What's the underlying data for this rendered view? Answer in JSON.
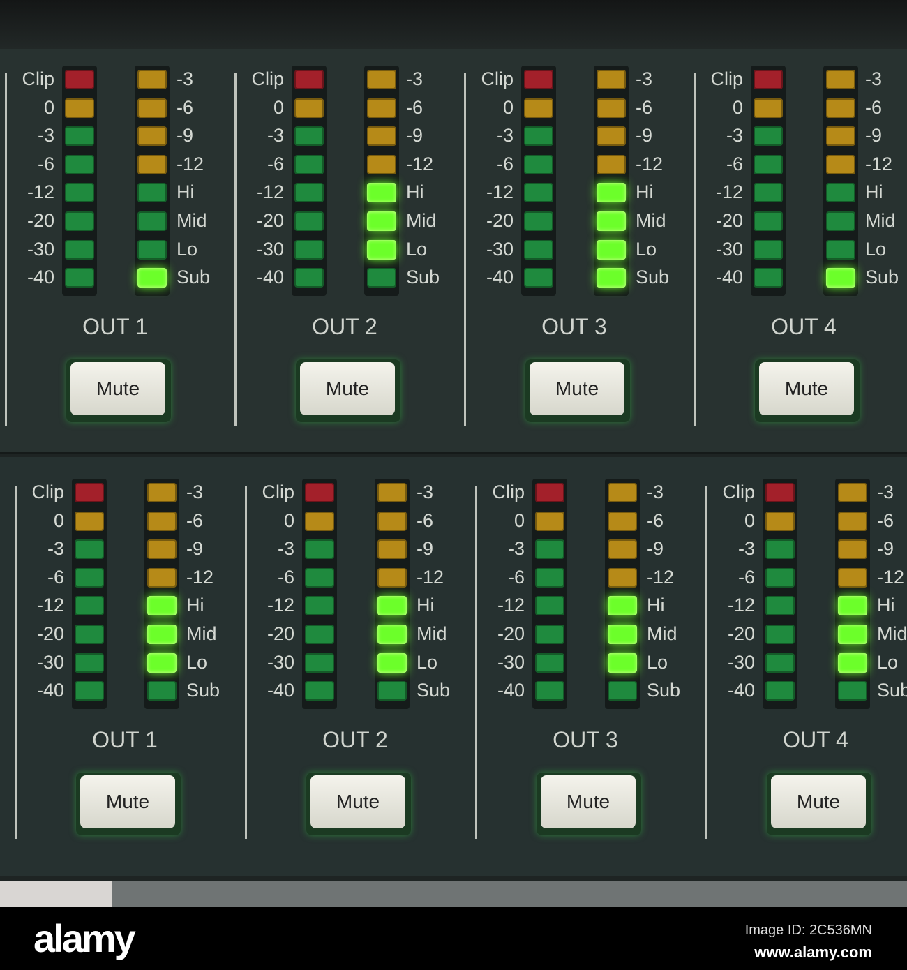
{
  "left_meter_labels": [
    "Clip",
    "0",
    "-3",
    "-6",
    "-12",
    "-20",
    "-30",
    "-40"
  ],
  "left_meter_colors": [
    "red",
    "yellow",
    "green",
    "green",
    "green",
    "green",
    "green",
    "green"
  ],
  "right_meter_labels": [
    "-3",
    "-6",
    "-9",
    "-12",
    "Hi",
    "Mid",
    "Lo",
    "Sub"
  ],
  "right_meter_colors": [
    "yellow",
    "yellow",
    "yellow",
    "yellow",
    "green",
    "green",
    "green",
    "green"
  ],
  "panels": [
    {
      "channels": [
        {
          "title": "OUT 1",
          "mute_label": "Mute",
          "lit_right": [
            "Sub"
          ]
        },
        {
          "title": "OUT 2",
          "mute_label": "Mute",
          "lit_right": [
            "Hi",
            "Mid",
            "Lo"
          ]
        },
        {
          "title": "OUT 3",
          "mute_label": "Mute",
          "lit_right": [
            "Hi",
            "Mid",
            "Lo",
            "Sub"
          ]
        },
        {
          "title": "OUT 4",
          "mute_label": "Mute",
          "lit_right": [
            "Sub"
          ]
        }
      ]
    },
    {
      "channels": [
        {
          "title": "OUT 1",
          "mute_label": "Mute",
          "lit_right": [
            "Hi",
            "Mid",
            "Lo"
          ]
        },
        {
          "title": "OUT 2",
          "mute_label": "Mute",
          "lit_right": [
            "Hi",
            "Mid",
            "Lo"
          ]
        },
        {
          "title": "OUT 3",
          "mute_label": "Mute",
          "lit_right": [
            "Hi",
            "Mid",
            "Lo"
          ]
        },
        {
          "title": "OUT 4",
          "mute_label": "Mute",
          "lit_right": [
            "Hi",
            "Mid",
            "Lo"
          ]
        }
      ]
    }
  ],
  "footer": {
    "logo": "alamy",
    "image_id": "Image ID: 2C536MN",
    "url": "www.alamy.com"
  }
}
